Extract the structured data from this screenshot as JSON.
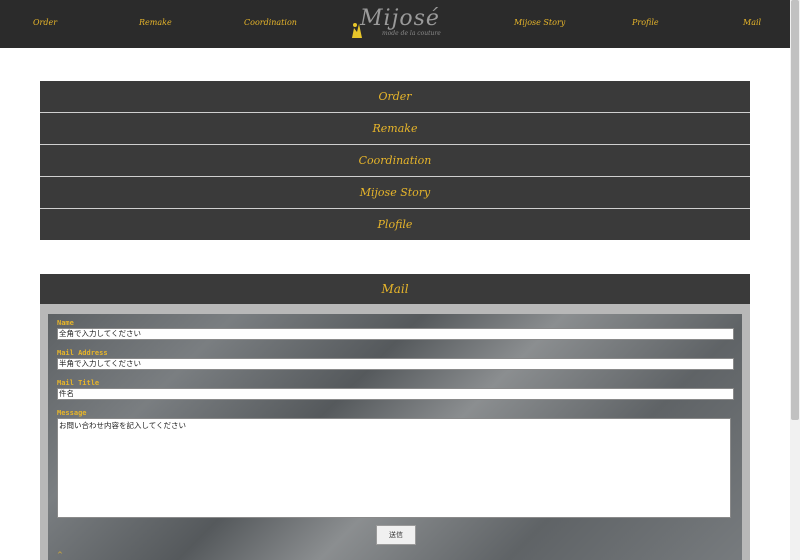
{
  "topnav": {
    "order": "Order",
    "remake": "Remake",
    "coordination": "Coordination",
    "story": "Mijose Story",
    "profile": "Profile",
    "mail": "Mail"
  },
  "logo": {
    "title": "Mijosé",
    "subtitle": "mode de la couture"
  },
  "menu": {
    "items": [
      "Order",
      "Remake",
      "Coordination",
      "Mijose Story",
      "Plofile"
    ]
  },
  "mail": {
    "header": "Mail",
    "name_label": "Name",
    "name_value": "全角で入力してください",
    "address_label": "Mail Address",
    "address_value": "半角で入力してください",
    "title_label": "Mail Title",
    "title_value": "件名",
    "message_label": "Message",
    "message_value": "お問い合わせ内容を記入してください",
    "submit_label": "送信"
  },
  "colors": {
    "accent": "#e7b52a",
    "bar": "#2b2b2b",
    "panel": "#3a3a3a"
  }
}
